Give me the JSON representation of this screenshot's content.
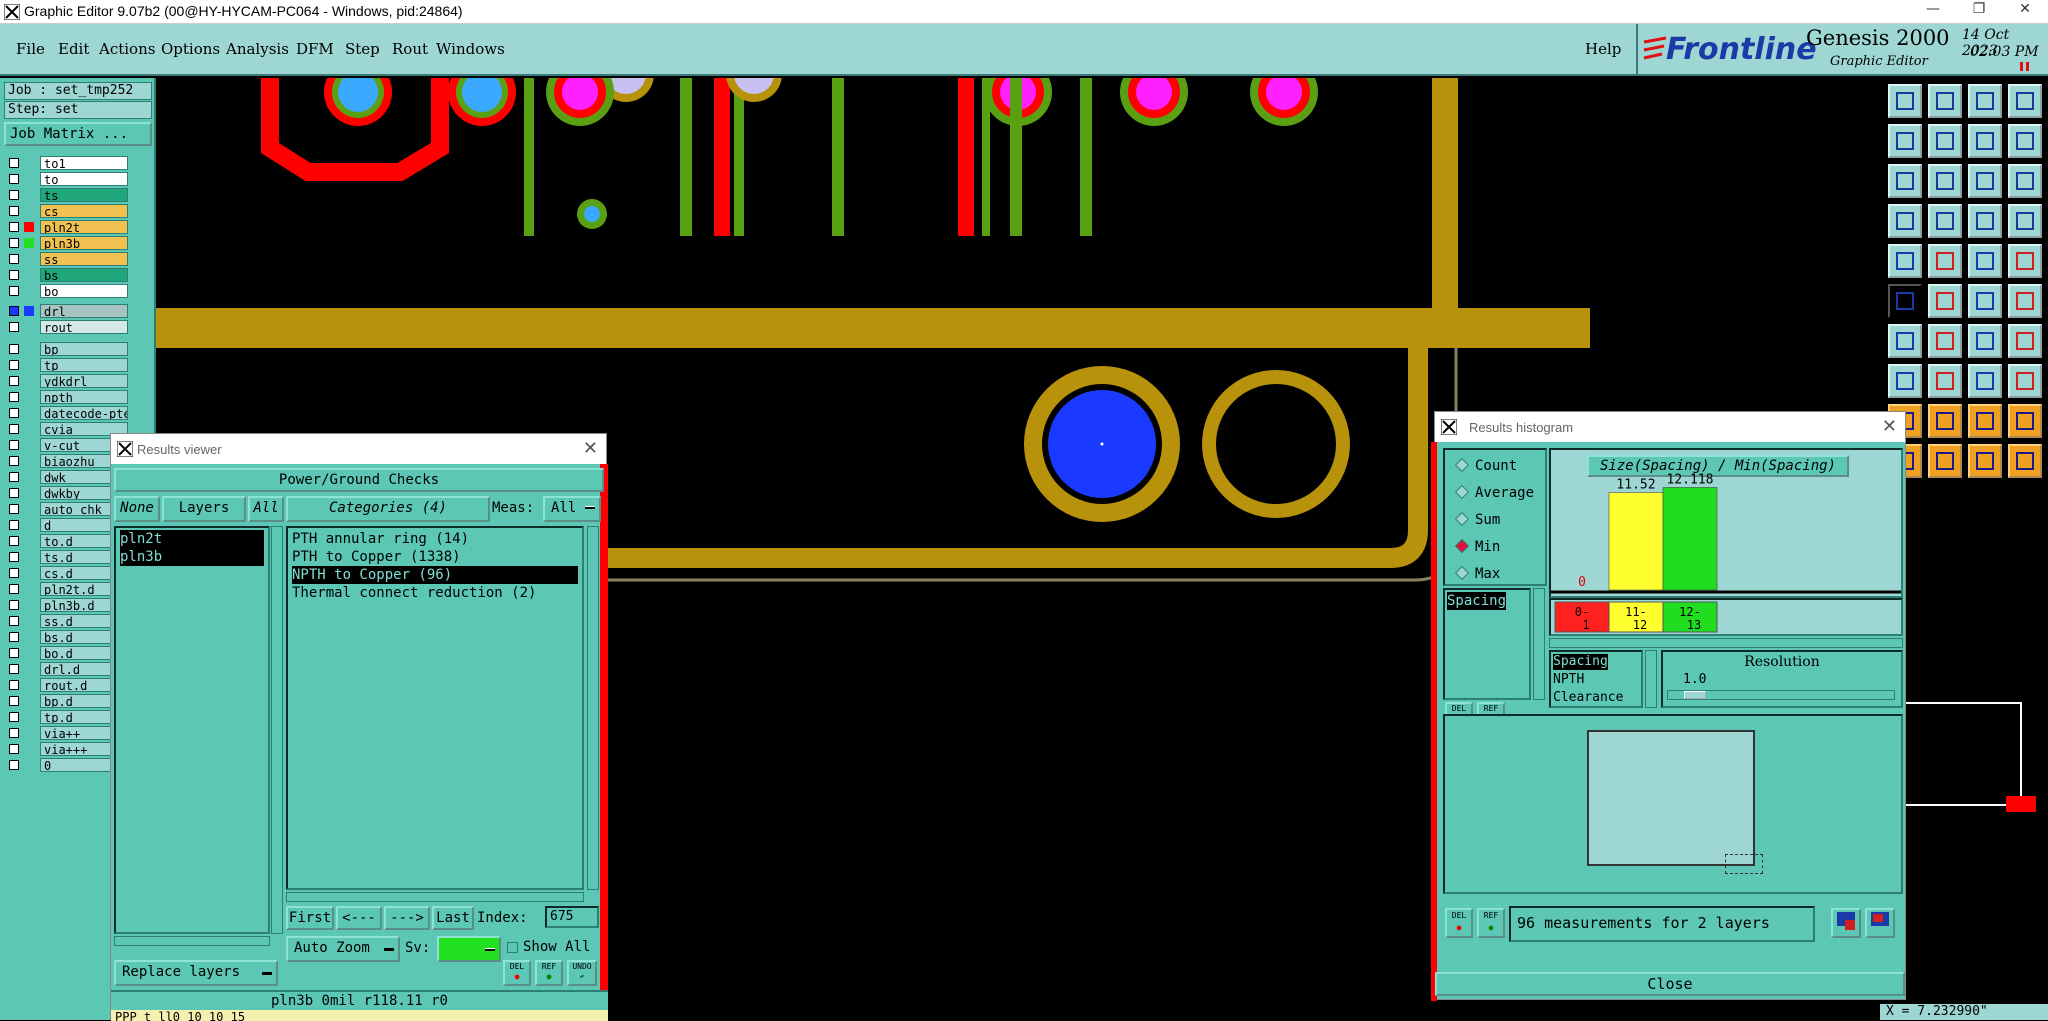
{
  "window": {
    "title": "Graphic Editor 9.07b2 (00@HY-HYCAM-PC064 - Windows, pid:24864)"
  },
  "menu": {
    "file": "File",
    "edit": "Edit",
    "actions": "Actions",
    "options": "Options",
    "analysis": "Analysis",
    "dfm": "DFM",
    "step": "Step",
    "rout": "Rout",
    "windows": "Windows",
    "help": "Help"
  },
  "brand": {
    "logo": "Frontline",
    "product": "Genesis 2000",
    "subtitle": "Graphic Editor",
    "date": "14 Oct 2023",
    "time": "02:03 PM"
  },
  "job": {
    "job_label": "Job : set_tmp252",
    "step_label": "Step: set",
    "matrix_button": "Job Matrix ..."
  },
  "layers": [
    {
      "name": "to1",
      "color": "#ffffff"
    },
    {
      "name": "to",
      "color": "#ffffff"
    },
    {
      "name": "ts",
      "color": "#1fa67a"
    },
    {
      "name": "cs",
      "color": "#f0c050"
    },
    {
      "name": "pln2t",
      "color": "#f0c050"
    },
    {
      "name": "pln3b",
      "color": "#f0c050"
    },
    {
      "name": "ss",
      "color": "#f0c050"
    },
    {
      "name": "bs",
      "color": "#1fa67a"
    },
    {
      "name": "bo",
      "color": "#ffffff"
    },
    {
      "name": "drl",
      "color": "#a8c4c2"
    },
    {
      "name": "rout",
      "color": "#d4e8e6"
    },
    {
      "name": "bp",
      "color": "#9ed6d4"
    },
    {
      "name": "tp",
      "color": "#9ed6d4"
    },
    {
      "name": "ydkdrl",
      "color": "#9ed6d4"
    },
    {
      "name": "npth",
      "color": "#9ed6d4"
    },
    {
      "name": "datecode-pte",
      "color": "#9ed6d4"
    },
    {
      "name": "cvia",
      "color": "#9ed6d4"
    },
    {
      "name": "v-cut",
      "color": "#9ed6d4"
    },
    {
      "name": "biaozhu",
      "color": "#9ed6d4"
    },
    {
      "name": "dwk",
      "color": "#9ed6d4"
    },
    {
      "name": "dwkby",
      "color": "#9ed6d4"
    },
    {
      "name": "auto_chk_p",
      "color": "#9ed6d4"
    },
    {
      "name": "d",
      "color": "#9ed6d4"
    },
    {
      "name": "to.d",
      "color": "#9ed6d4"
    },
    {
      "name": "ts.d",
      "color": "#9ed6d4"
    },
    {
      "name": "cs.d",
      "color": "#9ed6d4"
    },
    {
      "name": "pln2t.d",
      "color": "#9ed6d4"
    },
    {
      "name": "pln3b.d",
      "color": "#9ed6d4"
    },
    {
      "name": "ss.d",
      "color": "#9ed6d4"
    },
    {
      "name": "bs.d",
      "color": "#9ed6d4"
    },
    {
      "name": "bo.d",
      "color": "#9ed6d4"
    },
    {
      "name": "drl.d",
      "color": "#9ed6d4"
    },
    {
      "name": "rout.d",
      "color": "#9ed6d4"
    },
    {
      "name": "bp.d",
      "color": "#9ed6d4"
    },
    {
      "name": "tp.d",
      "color": "#9ed6d4"
    },
    {
      "name": "via++",
      "color": "#9ed6d4"
    },
    {
      "name": "via+++",
      "color": "#9ed6d4"
    },
    {
      "name": "0",
      "color": "#9ed6d4"
    }
  ],
  "results_viewer": {
    "title": "Results viewer",
    "header": "Power/Ground Checks",
    "none_btn": "None",
    "layers_btn": "Layers",
    "all_btn": "All",
    "categories_btn": "Categories (4)",
    "meas_label": "Meas:",
    "meas_value": "All",
    "layer_list": [
      "pln2t",
      "pln3b"
    ],
    "categories": [
      "PTH annular ring (14)",
      "PTH to Copper (1338)",
      "NPTH to Copper (96)",
      "Thermal connect reduction (2)"
    ],
    "first": "First",
    "prev": "<---",
    "next": "--->",
    "last": "Last",
    "index_label": "Index:",
    "index_value": "675",
    "auto_zoom": "Auto Zoom",
    "sv_label": "Sv:",
    "show_all": "Show All",
    "replace_layers": "Replace layers",
    "status": "pln3b 0mil  r118.11  r0",
    "status2": "PPP t  ll0    10 10 15"
  },
  "histogram": {
    "title": "Results histogram",
    "radios": [
      "Count",
      "Average",
      "Sum",
      "Min",
      "Max"
    ],
    "selected": "Min",
    "list": [
      "Spacing"
    ],
    "chart_title": "Size(Spacing) / Min(Spacing)",
    "measures": [
      "Spacing",
      "NPTH",
      "Clearance"
    ],
    "resolution_label": "Resolution",
    "resolution_value": "1.0",
    "measurement_text": "96 measurements for 2 layers",
    "close": "Close",
    "colors": {
      "bin1": "#ff2020",
      "bin2": "#ffff30",
      "bin3": "#20dd20"
    }
  },
  "chart_data": {
    "type": "bar",
    "categories": [
      "0-1",
      "11-12",
      "12-13"
    ],
    "values": [
      0,
      11.52,
      12.118
    ],
    "value_labels": [
      "0",
      "11.52",
      "12.118"
    ],
    "title": "Size(Spacing) / Min(Spacing)"
  },
  "coords": {
    "x": "X = 7.232990\""
  }
}
